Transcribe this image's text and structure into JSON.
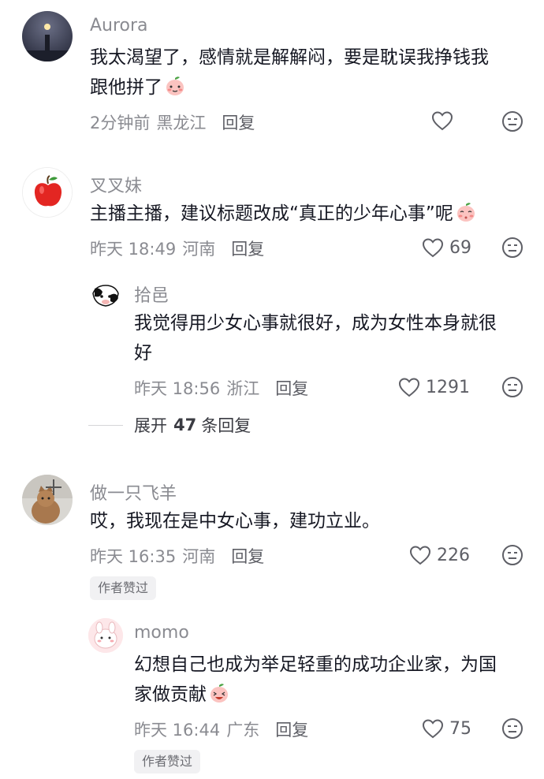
{
  "comments": [
    {
      "username": "Aurora",
      "text_line1": "我太渴望了，感情就是解解闷，要是耽误我挣钱我",
      "text_line2": "跟他拼了",
      "emoji": "blushing-peach-emoji",
      "time": "2分钟前",
      "location": "黑龙江",
      "reply_label": "回复",
      "likes": "",
      "avatar": "night-lighthouse-avatar"
    },
    {
      "username": "叉叉妹",
      "text_line1": "主播主播，建议标题改成“真正的少年心事”呢",
      "emoji": "shy-peach-emoji",
      "time": "昨天 18:49",
      "location": "河南",
      "reply_label": "回复",
      "likes": "69",
      "avatar": "red-apple-avatar"
    },
    {
      "username": "拾邑",
      "text_line1": "我觉得用少女心事就很好，成为女性本身就很",
      "text_line2": "好",
      "time": "昨天 18:56",
      "location": "浙江",
      "reply_label": "回复",
      "likes": "1291",
      "avatar": "cow-cartoon-avatar"
    },
    {
      "username": "做一只飞羊",
      "text_line1": "哎，我现在是中女心事，建功立业。",
      "time": "昨天 16:35",
      "location": "河南",
      "reply_label": "回复",
      "likes": "226",
      "badge": "作者赞过",
      "avatar": "cat-with-windmill-avatar"
    },
    {
      "username": "momo",
      "text_line1": "幻想自己也成为举足轻重的成功企业家，为国",
      "text_line2": "家做贡献",
      "emoji": "laughing-peach-emoji",
      "time": "昨天 16:44",
      "location": "广东",
      "reply_label": "回复",
      "likes": "75",
      "badge": "作者赞过",
      "avatar": "pink-bunny-avatar"
    }
  ],
  "expand": {
    "prefix": "展开",
    "count": "47",
    "suffix": "条回复"
  },
  "colors": {
    "text": "#161823",
    "meta": "#8a8b91",
    "badge_bg": "#f1f1f3"
  }
}
